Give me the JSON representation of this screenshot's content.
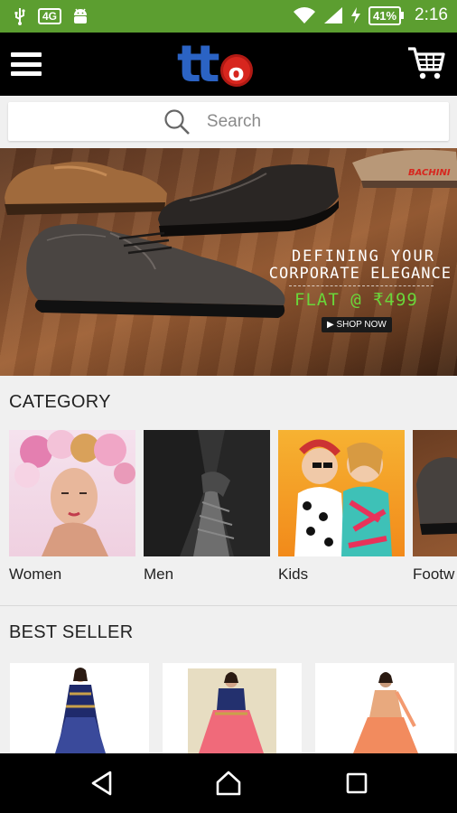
{
  "status_bar": {
    "sim_badge": "4G",
    "battery": "41%",
    "time": "2:16"
  },
  "app_bar": {
    "logo_text": "tto",
    "logo_t": "t",
    "logo_o": "o"
  },
  "search": {
    "placeholder": "Search"
  },
  "banner": {
    "brand": "BACHINI",
    "line1": "DEFINING YOUR",
    "line2": "CORPORATE ELEGANCE",
    "offer": "FLAT @ ₹499",
    "cta": "SHOP NOW"
  },
  "category": {
    "title": "CATEGORY",
    "items": [
      {
        "label": "Women"
      },
      {
        "label": "Men"
      },
      {
        "label": "Kids"
      },
      {
        "label": "Footw"
      }
    ]
  },
  "best_seller": {
    "title": "BEST SELLER"
  },
  "colors": {
    "status_bar": "#5c9e30",
    "app_bar": "#000000",
    "logo_blue": "#2b63c4",
    "logo_red": "#d7261e",
    "offer_green": "#6ad63a"
  },
  "icons": [
    "usb-icon",
    "sim-icon",
    "android-icon",
    "wifi-icon",
    "signal-icon",
    "charging-icon",
    "menu-icon",
    "cart-icon",
    "search-icon",
    "back-icon",
    "home-icon",
    "recents-icon"
  ]
}
